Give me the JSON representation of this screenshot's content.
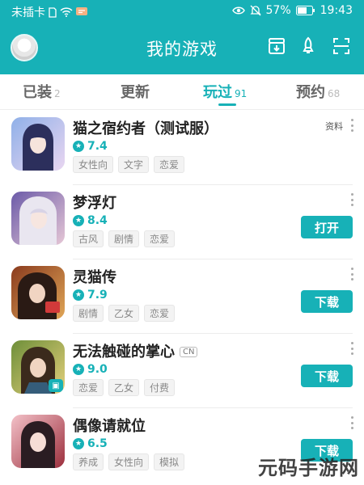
{
  "status_bar": {
    "carrier": "未插卡",
    "battery": "57%",
    "time": "19:43"
  },
  "header": {
    "title": "我的游戏",
    "icons": [
      "download-box-icon",
      "rocket-icon",
      "scan-icon"
    ]
  },
  "tabs": [
    {
      "label": "已装",
      "count": "2",
      "active": false
    },
    {
      "label": "更新",
      "count": "",
      "active": false
    },
    {
      "label": "玩过",
      "count": "91",
      "active": true
    },
    {
      "label": "预约",
      "count": "68",
      "active": false
    }
  ],
  "games": [
    {
      "name": "猫之宿约者（测试服）",
      "rating": "7.4",
      "tags": [
        "女性向",
        "文字",
        "恋爱"
      ],
      "info_link": "资料",
      "action": ""
    },
    {
      "name": "梦浮灯",
      "rating": "8.4",
      "tags": [
        "古风",
        "剧情",
        "恋爱"
      ],
      "info_link": "",
      "action": "打开"
    },
    {
      "name": "灵猫传",
      "rating": "7.9",
      "tags": [
        "剧情",
        "乙女",
        "恋爱"
      ],
      "info_link": "",
      "action": "下载"
    },
    {
      "name": "无法触碰的掌心",
      "badge": "CN",
      "rating": "9.0",
      "tags": [
        "恋爱",
        "乙女",
        "付费"
      ],
      "info_link": "",
      "action": "下载"
    },
    {
      "name": "偶像请就位",
      "rating": "6.5",
      "tags": [
        "养成",
        "女性向",
        "模拟"
      ],
      "info_link": "",
      "action": "下载"
    }
  ],
  "watermark": "元码手游网",
  "colors": {
    "accent": "#17b1b7",
    "text_primary": "#222222",
    "tag_text": "#888888"
  }
}
